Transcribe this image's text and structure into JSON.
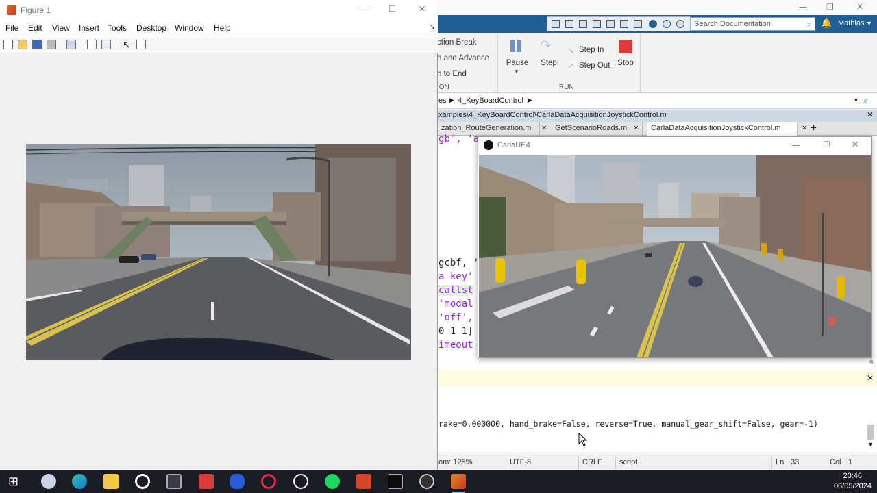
{
  "figure_window": {
    "title": "Figure 1",
    "menu": [
      "File",
      "Edit",
      "View",
      "Insert",
      "Tools",
      "Desktop",
      "Window",
      "Help"
    ],
    "menu_arrow": "↘"
  },
  "matlab_window": {
    "search_placeholder": "Search Documentation",
    "user": "Mathias",
    "ribbon": {
      "section_break": "ction Break",
      "run_and_advance": "n and Advance",
      "run_to_end": "n to End",
      "section_label": "ION",
      "pause": "Pause",
      "step": "Step",
      "step_in": "Step In",
      "step_out": "Step Out",
      "stop": "Stop",
      "run_label": "RUN"
    },
    "address": {
      "part1": "es",
      "part2": "4_KeyBoardControl"
    },
    "editor_title": "xamples\\4_KeyBoardControl\\CarlaDataAcquisitionJoystickControl.m",
    "tabs": [
      "zation_RouteGeneration.m",
      "GetScenarioRoads.m",
      "CarlaDataAcquisitionJoystickControl.m"
    ],
    "code_lines": [
      "gb\", 'a",
      "gcbf, '",
      " a key'",
      " callst",
      " 'modal",
      " 'off',",
      "0 1 1]",
      "imeout"
    ],
    "command_output": "rake=0.000000, hand_brake=False, reverse=True, manual_gear_shift=False, gear=-1)",
    "status": {
      "zoom": "om: 125%",
      "encoding": "UTF-8",
      "line_ending": "CRLF",
      "file_type": "script",
      "ln_label": "Ln",
      "ln": "33",
      "col_label": "Col",
      "col": "1"
    }
  },
  "carla_window": {
    "title": "CarlaUE4"
  },
  "taskbar": {
    "time": "20:46",
    "date": "06/05/2024"
  },
  "colors": {
    "matlab_blue": "#1f5f95",
    "stop_red": "#e03a3a",
    "code_purple": "#a020f0",
    "taskbar": "#1b1b24"
  }
}
